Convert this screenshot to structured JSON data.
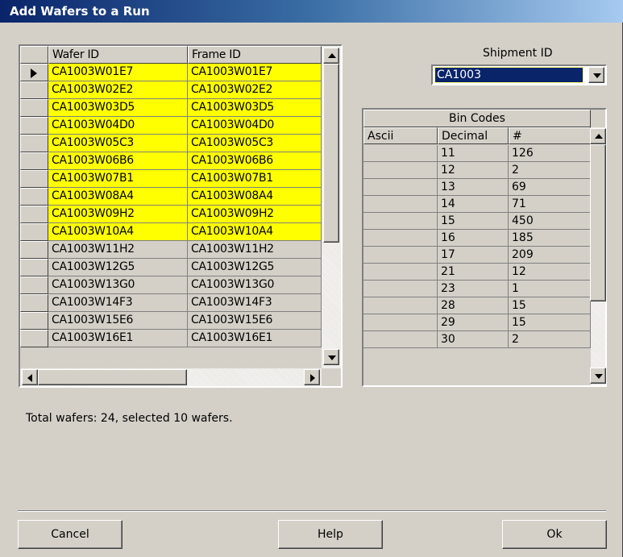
{
  "window": {
    "title": "Add Wafers to a Run"
  },
  "wafer_grid": {
    "columns": [
      "Wafer ID",
      "Frame ID"
    ],
    "current_row": 0,
    "rows": [
      {
        "wafer_id": "CA1003W01E7",
        "frame_id": "CA1003W01E7",
        "selected": true
      },
      {
        "wafer_id": "CA1003W02E2",
        "frame_id": "CA1003W02E2",
        "selected": true
      },
      {
        "wafer_id": "CA1003W03D5",
        "frame_id": "CA1003W03D5",
        "selected": true
      },
      {
        "wafer_id": "CA1003W04D0",
        "frame_id": "CA1003W04D0",
        "selected": true
      },
      {
        "wafer_id": "CA1003W05C3",
        "frame_id": "CA1003W05C3",
        "selected": true
      },
      {
        "wafer_id": "CA1003W06B6",
        "frame_id": "CA1003W06B6",
        "selected": true
      },
      {
        "wafer_id": "CA1003W07B1",
        "frame_id": "CA1003W07B1",
        "selected": true
      },
      {
        "wafer_id": "CA1003W08A4",
        "frame_id": "CA1003W08A4",
        "selected": true
      },
      {
        "wafer_id": "CA1003W09H2",
        "frame_id": "CA1003W09H2",
        "selected": true
      },
      {
        "wafer_id": "CA1003W10A4",
        "frame_id": "CA1003W10A4",
        "selected": true
      },
      {
        "wafer_id": "CA1003W11H2",
        "frame_id": "CA1003W11H2",
        "selected": false
      },
      {
        "wafer_id": "CA1003W12G5",
        "frame_id": "CA1003W12G5",
        "selected": false
      },
      {
        "wafer_id": "CA1003W13G0",
        "frame_id": "CA1003W13G0",
        "selected": false
      },
      {
        "wafer_id": "CA1003W14F3",
        "frame_id": "CA1003W14F3",
        "selected": false
      },
      {
        "wafer_id": "CA1003W15E6",
        "frame_id": "CA1003W15E6",
        "selected": false
      },
      {
        "wafer_id": "CA1003W16E1",
        "frame_id": "CA1003W16E1",
        "selected": false
      }
    ]
  },
  "shipment": {
    "label": "Shipment ID",
    "value": "CA1003"
  },
  "bin_codes": {
    "title": "Bin Codes",
    "columns": [
      "Ascii",
      "Decimal",
      "#"
    ],
    "rows": [
      {
        "ascii": "",
        "decimal": "11",
        "count": "126"
      },
      {
        "ascii": "",
        "decimal": "12",
        "count": "2"
      },
      {
        "ascii": "",
        "decimal": "13",
        "count": "69"
      },
      {
        "ascii": "",
        "decimal": "14",
        "count": "71"
      },
      {
        "ascii": "",
        "decimal": "15",
        "count": "450"
      },
      {
        "ascii": "",
        "decimal": "16",
        "count": "185"
      },
      {
        "ascii": "",
        "decimal": "17",
        "count": "209"
      },
      {
        "ascii": "",
        "decimal": "21",
        "count": "12"
      },
      {
        "ascii": "",
        "decimal": "23",
        "count": "1"
      },
      {
        "ascii": "",
        "decimal": "28",
        "count": "15"
      },
      {
        "ascii": "",
        "decimal": "29",
        "count": "15"
      },
      {
        "ascii": "",
        "decimal": "30",
        "count": "2"
      }
    ]
  },
  "status": {
    "text": "Total wafers: 24, selected 10 wafers."
  },
  "buttons": {
    "cancel": "Cancel",
    "help": "Help",
    "ok": "Ok"
  },
  "colors": {
    "selected_row": "#ffff00",
    "title_bar": "#0a246a",
    "face": "#d4d0c8"
  }
}
